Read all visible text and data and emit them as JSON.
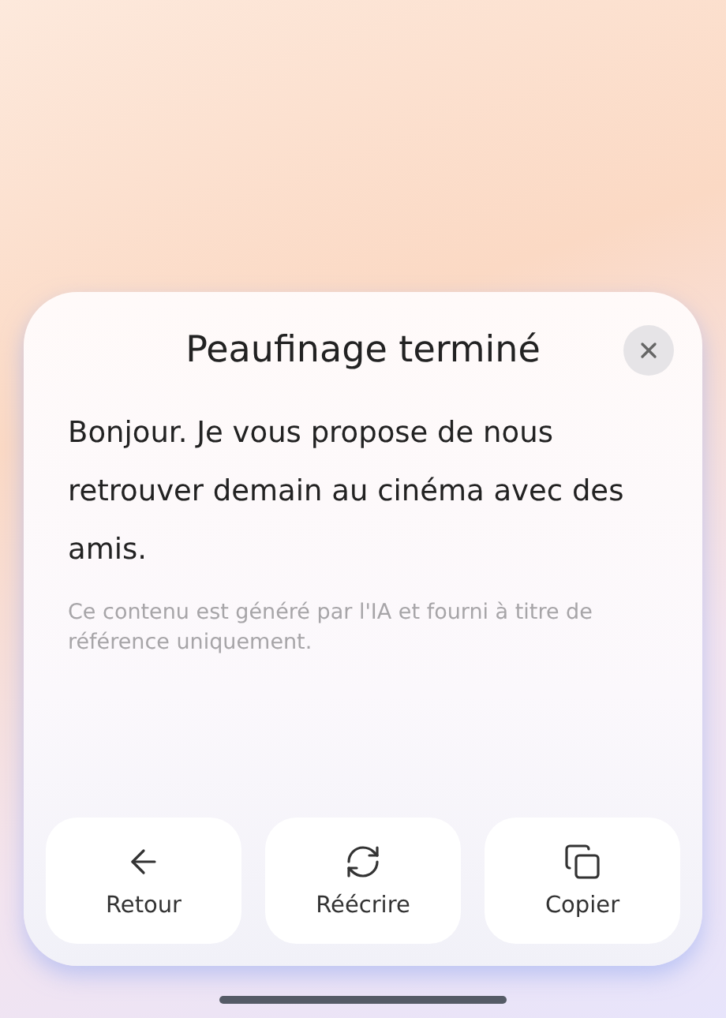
{
  "dialog": {
    "title": "Peaufinage terminé",
    "message": "Bonjour. Je vous propose de nous retrouver demain au cinéma avec des amis.",
    "disclaimer": "Ce contenu est généré par l'IA et fourni à titre de référence uniquement.",
    "actions": [
      {
        "kind": "back",
        "label": "Retour"
      },
      {
        "kind": "rewrite",
        "label": "Réécrire"
      },
      {
        "kind": "copy",
        "label": "Copier"
      }
    ]
  }
}
